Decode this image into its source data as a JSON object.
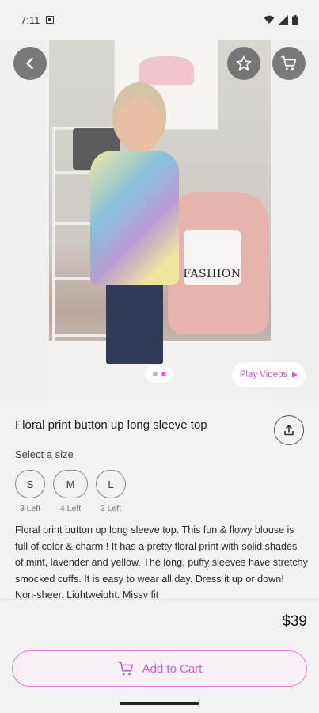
{
  "status_bar": {
    "time": "7:11"
  },
  "hero": {
    "pillow_text": "FASHION",
    "pager": {
      "count": 2,
      "active_index": 1
    },
    "play_videos_label": "Play Videos"
  },
  "product": {
    "title": "Floral print button up long sleeve top",
    "size_label": "Select a size",
    "sizes": [
      {
        "label": "S",
        "stock": "3 Left"
      },
      {
        "label": "M",
        "stock": "4 Left"
      },
      {
        "label": "L",
        "stock": "3 Left"
      }
    ],
    "description": "Floral print button up long sleeve top. This fun & flowy blouse is full of color & charm !  It has a pretty floral print with solid shades of mint, lavender and yellow.  The long, puffy sleeves have stretchy smocked cuffs.  It is easy to wear all day.  Dress it up or down! Non-sheer. Lightweight. Missy fit"
  },
  "footer": {
    "price": "$39",
    "add_to_cart_label": "Add to Cart"
  },
  "colors": {
    "accent": "#d85ad0",
    "accent_border": "#e47fd9"
  },
  "icons": [
    "back-arrow-icon",
    "star-icon",
    "cart-icon",
    "share-icon",
    "play-icon",
    "wifi-icon",
    "signal-icon",
    "battery-icon"
  ]
}
